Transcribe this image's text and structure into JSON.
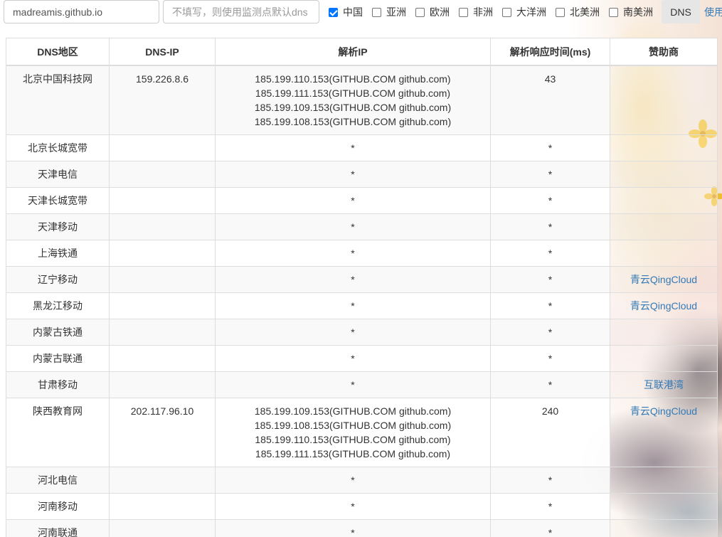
{
  "toolbar": {
    "domain_value": "madreamis.github.io",
    "dns_placeholder": "不填写，则使用监测点默认dns",
    "regions": [
      {
        "label": "中国",
        "checked": true
      },
      {
        "label": "亚洲",
        "checked": false
      },
      {
        "label": "欧洲",
        "checked": false
      },
      {
        "label": "非洲",
        "checked": false
      },
      {
        "label": "大洋洲",
        "checked": false
      },
      {
        "label": "北美洲",
        "checked": false
      },
      {
        "label": "南美洲",
        "checked": false
      }
    ],
    "dns_button": "DNS",
    "use_link": "使用"
  },
  "table": {
    "headers": [
      "DNS地区",
      "DNS-IP",
      "解析IP",
      "解析响应时间(ms)",
      "赞助商"
    ],
    "rows": [
      {
        "region": "北京中国科技网",
        "dns_ip": "159.226.8.6",
        "ips": [
          "185.199.110.153(GITHUB.COM github.com)",
          "185.199.111.153(GITHUB.COM github.com)",
          "185.199.109.153(GITHUB.COM github.com)",
          "185.199.108.153(GITHUB.COM github.com)"
        ],
        "time": "43",
        "sponsor": ""
      },
      {
        "region": "北京长城宽带",
        "dns_ip": "",
        "ips": [
          "*"
        ],
        "time": "*",
        "sponsor": ""
      },
      {
        "region": "天津电信",
        "dns_ip": "",
        "ips": [
          "*"
        ],
        "time": "*",
        "sponsor": ""
      },
      {
        "region": "天津长城宽带",
        "dns_ip": "",
        "ips": [
          "*"
        ],
        "time": "*",
        "sponsor": ""
      },
      {
        "region": "天津移动",
        "dns_ip": "",
        "ips": [
          "*"
        ],
        "time": "*",
        "sponsor": ""
      },
      {
        "region": "上海铁通",
        "dns_ip": "",
        "ips": [
          "*"
        ],
        "time": "*",
        "sponsor": ""
      },
      {
        "region": "辽宁移动",
        "dns_ip": "",
        "ips": [
          "*"
        ],
        "time": "*",
        "sponsor": "青云QingCloud"
      },
      {
        "region": "黑龙江移动",
        "dns_ip": "",
        "ips": [
          "*"
        ],
        "time": "*",
        "sponsor": "青云QingCloud"
      },
      {
        "region": "内蒙古铁通",
        "dns_ip": "",
        "ips": [
          "*"
        ],
        "time": "*",
        "sponsor": ""
      },
      {
        "region": "内蒙古联通",
        "dns_ip": "",
        "ips": [
          "*"
        ],
        "time": "*",
        "sponsor": ""
      },
      {
        "region": "甘肃移动",
        "dns_ip": "",
        "ips": [
          "*"
        ],
        "time": "*",
        "sponsor": "互联港湾"
      },
      {
        "region": "陕西教育网",
        "dns_ip": "202.117.96.10",
        "ips": [
          "185.199.109.153(GITHUB.COM github.com)",
          "185.199.108.153(GITHUB.COM github.com)",
          "185.199.110.153(GITHUB.COM github.com)",
          "185.199.111.153(GITHUB.COM github.com)"
        ],
        "time": "240",
        "sponsor": "青云QingCloud"
      },
      {
        "region": "河北电信",
        "dns_ip": "",
        "ips": [
          "*"
        ],
        "time": "*",
        "sponsor": ""
      },
      {
        "region": "河南移动",
        "dns_ip": "",
        "ips": [
          "*"
        ],
        "time": "*",
        "sponsor": ""
      },
      {
        "region": "河南联通",
        "dns_ip": "",
        "ips": [
          "*"
        ],
        "time": "*",
        "sponsor": ""
      }
    ]
  }
}
